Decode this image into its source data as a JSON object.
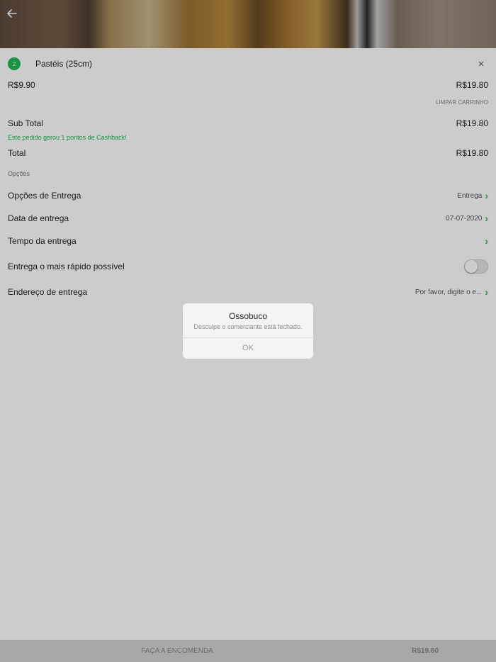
{
  "header": {
    "back_icon": "arrow-left-icon"
  },
  "cart_item": {
    "quantity": "2",
    "name": "Pastéis (25cm)",
    "unit_price": "R$9.90",
    "line_total": "R$19.80",
    "remove_icon": "close-icon"
  },
  "clear_cart": "LIMPAR CARRINHO",
  "summary": {
    "subtotal_label": "Sub Total",
    "subtotal_value": "R$19.80",
    "cashback_note": "Este pedido gerou 1 pontos de Cashback!",
    "total_label": "Total",
    "total_value": "R$19.80"
  },
  "options": {
    "section_label": "Opções",
    "delivery_options_label": "Opções de Entrega",
    "delivery_options_value": "Entrega",
    "delivery_date_label": "Data de entrega",
    "delivery_date_value": "07-07-2020",
    "delivery_time_label": "Tempo da entrega",
    "delivery_time_value": "",
    "asap_label": "Entrega o mais rápido possível",
    "asap_enabled": false,
    "address_label": "Endereço de entrega",
    "address_value": "Por favor, digite o e..."
  },
  "dialog": {
    "title": "Ossobuco",
    "message": "Desculpe o comerciante está fechado.",
    "ok_label": "OK"
  },
  "bottom_bar": {
    "order_label": "FAÇA A ENCOMENDA",
    "total": "R$19.80"
  },
  "colors": {
    "accent": "#1db954",
    "overlay": "rgba(0,0,0,0.2)"
  }
}
